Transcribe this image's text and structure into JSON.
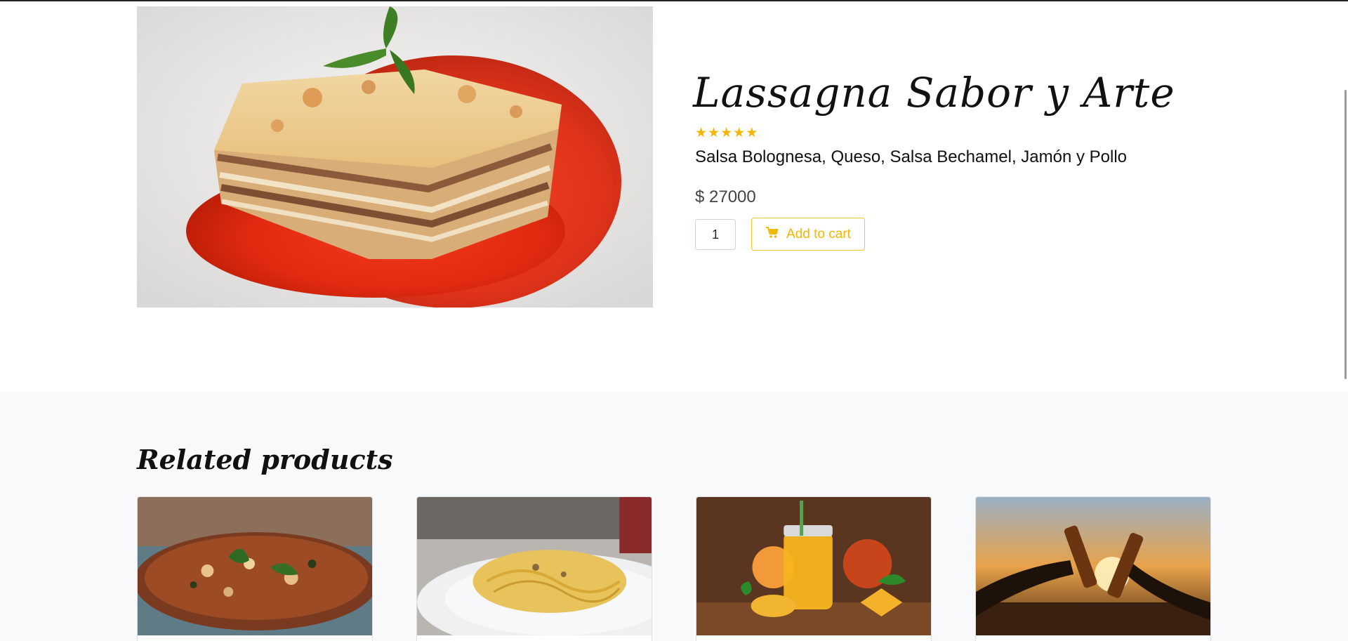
{
  "product": {
    "title": "Lassagna Sabor y Arte",
    "rating": 5,
    "stars": [
      "★",
      "★",
      "★",
      "★",
      "★"
    ],
    "description": "Salsa Bolognesa, Queso, Salsa Bechamel, Jamón y Pollo",
    "price": "$ 27000",
    "quantity": "1",
    "add_to_cart_label": "Add to cart"
  },
  "related": {
    "title": "Related products",
    "items": [
      {
        "image": "pizza-image"
      },
      {
        "image": "spaghetti-image"
      },
      {
        "image": "mango-juice-image"
      },
      {
        "image": "beer-toast-image"
      }
    ]
  },
  "colors": {
    "accent": "#f6c62a",
    "star": "#f7b500",
    "related_bg": "#f8f9fa"
  },
  "icons": {
    "cart": "cart-icon",
    "star": "star-icon"
  }
}
